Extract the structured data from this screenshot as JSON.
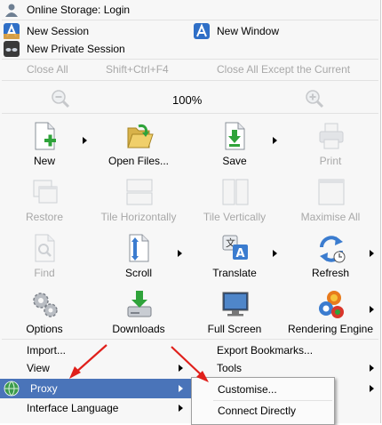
{
  "top": {
    "online_storage": "Online Storage: Login",
    "new_session": "New Session",
    "new_window": "New Window",
    "new_private_session": "New Private Session"
  },
  "close_row": {
    "close_all": "Close All",
    "shortcut": "Shift+Ctrl+F4",
    "close_all_except": "Close All Except the Current"
  },
  "zoom": {
    "level": "100%"
  },
  "tiles_row1": [
    "New",
    "Open Files...",
    "Save",
    "Print"
  ],
  "tiles_row2": [
    "Restore",
    "Tile Horizontally",
    "Tile Vertically",
    "Maximise All"
  ],
  "tiles_row3": [
    "Find",
    "Scroll",
    "Translate",
    "Refresh"
  ],
  "tiles_row4": [
    "Options",
    "Downloads",
    "Full Screen",
    "Rendering Engine"
  ],
  "bottom": {
    "import": "Import...",
    "export_bookmarks": "Export Bookmarks...",
    "view": "View",
    "tools": "Tools",
    "proxy": "Proxy",
    "interface_language": "Interface Language"
  },
  "submenu": {
    "customise": "Customise...",
    "connect_directly": "Connect Directly"
  },
  "colors": {
    "highlight": "#4a74b9",
    "arrow": "#e0201b",
    "disabled_text": "#a8a8a8"
  }
}
